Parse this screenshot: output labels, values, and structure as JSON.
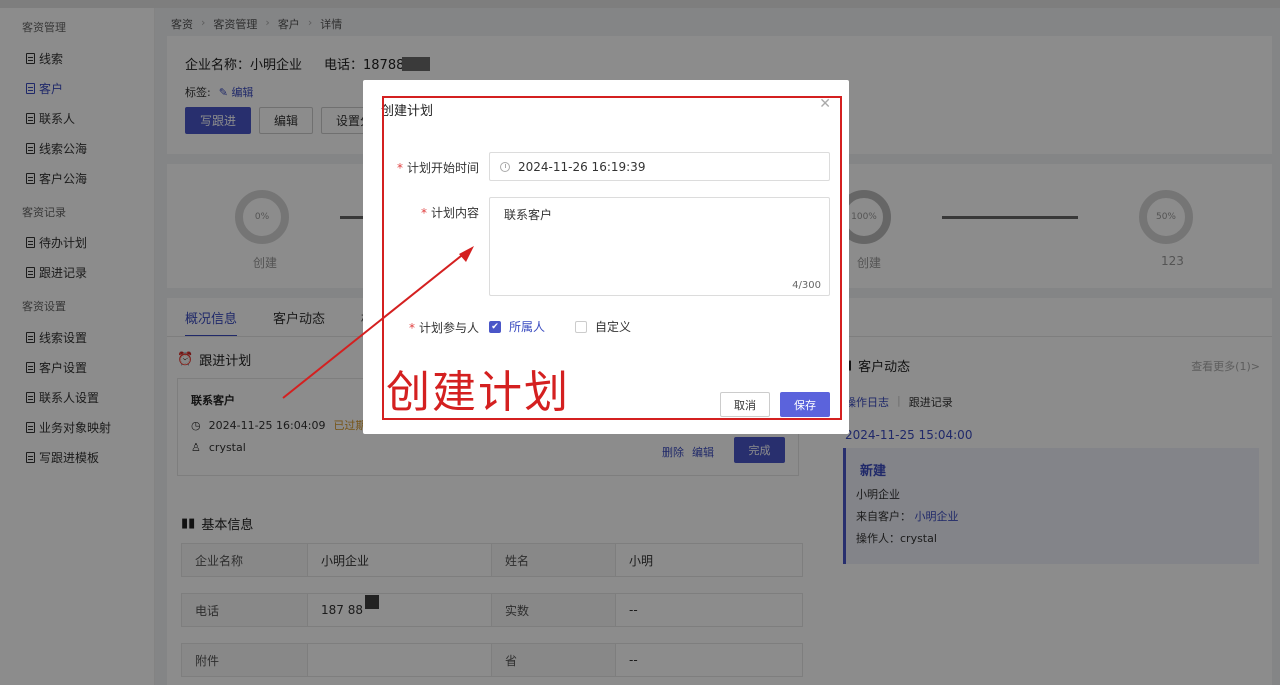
{
  "sidebar": {
    "groups": [
      {
        "label": "客资管理",
        "items": [
          "线索",
          "客户",
          "联系人",
          "线索公海",
          "客户公海"
        ]
      },
      {
        "label": "客资记录",
        "items": [
          "待办计划",
          "跟进记录"
        ]
      },
      {
        "label": "客资设置",
        "items": [
          "线索设置",
          "客户设置",
          "联系人设置",
          "业务对象映射",
          "写跟进模板"
        ]
      }
    ],
    "active": "客户"
  },
  "breadcrumb": [
    "客资",
    "客资管理",
    "客户",
    "详情"
  ],
  "header": {
    "company_label": "企业名称：小明企业",
    "phone_label": "电话：1878888",
    "tags_label": "标签:",
    "tags_edit": "编辑",
    "buttons": {
      "follow": "写跟进",
      "edit": "编辑",
      "set": "设置分"
    }
  },
  "progress": {
    "steps": [
      {
        "percent": "0%",
        "label": "创建"
      },
      {
        "percent": "100%",
        "label": "创建"
      },
      {
        "percent": "50%",
        "label": "123"
      }
    ]
  },
  "tabs": {
    "overview": "概况信息",
    "dynamics": "客户动态",
    "more": "相"
  },
  "plan": {
    "title": "跟进计划",
    "name": "联系客户",
    "time": "2024-11-25 16:04:09",
    "overdue": "已过期1",
    "user": "crystal",
    "delete": "删除",
    "edit": "编辑",
    "done": "完成"
  },
  "basic": {
    "title": "基本信息",
    "rows": [
      {
        "k1": "企业名称",
        "v1": "小明企业",
        "k2": "姓名",
        "v2": "小明"
      },
      {
        "k1": "电话",
        "v1": "187    88",
        "k2": "实数",
        "v2": "--"
      },
      {
        "k1": "附件",
        "v1": "",
        "k2": "省",
        "v2": "--"
      }
    ]
  },
  "dynamics": {
    "title": "客户动态",
    "more": "查看更多(1)>",
    "tab_a": "操作日志",
    "tab_b": "跟进记录",
    "date": "2024-11-25 15:04:00",
    "card": {
      "title": "新建",
      "line1": "小明企业",
      "from_label": "来自客户：",
      "from_value": "小明企业",
      "operator": "操作人：crystal"
    }
  },
  "modal": {
    "title": "创建计划",
    "start_label": "计划开始时间",
    "start_value": "2024-11-26 16:19:39",
    "content_label": "计划内容",
    "content_value": "联系客户",
    "counter": "4/300",
    "participants_label": "计划参与人",
    "opt_owner": "所属人",
    "opt_custom": "自定义",
    "cancel": "取消",
    "save": "保存"
  },
  "annotation": {
    "text": "创建计划",
    "color": "#d42020"
  },
  "colors": {
    "accent": "#4a56c8",
    "link": "#3b4cc0"
  }
}
